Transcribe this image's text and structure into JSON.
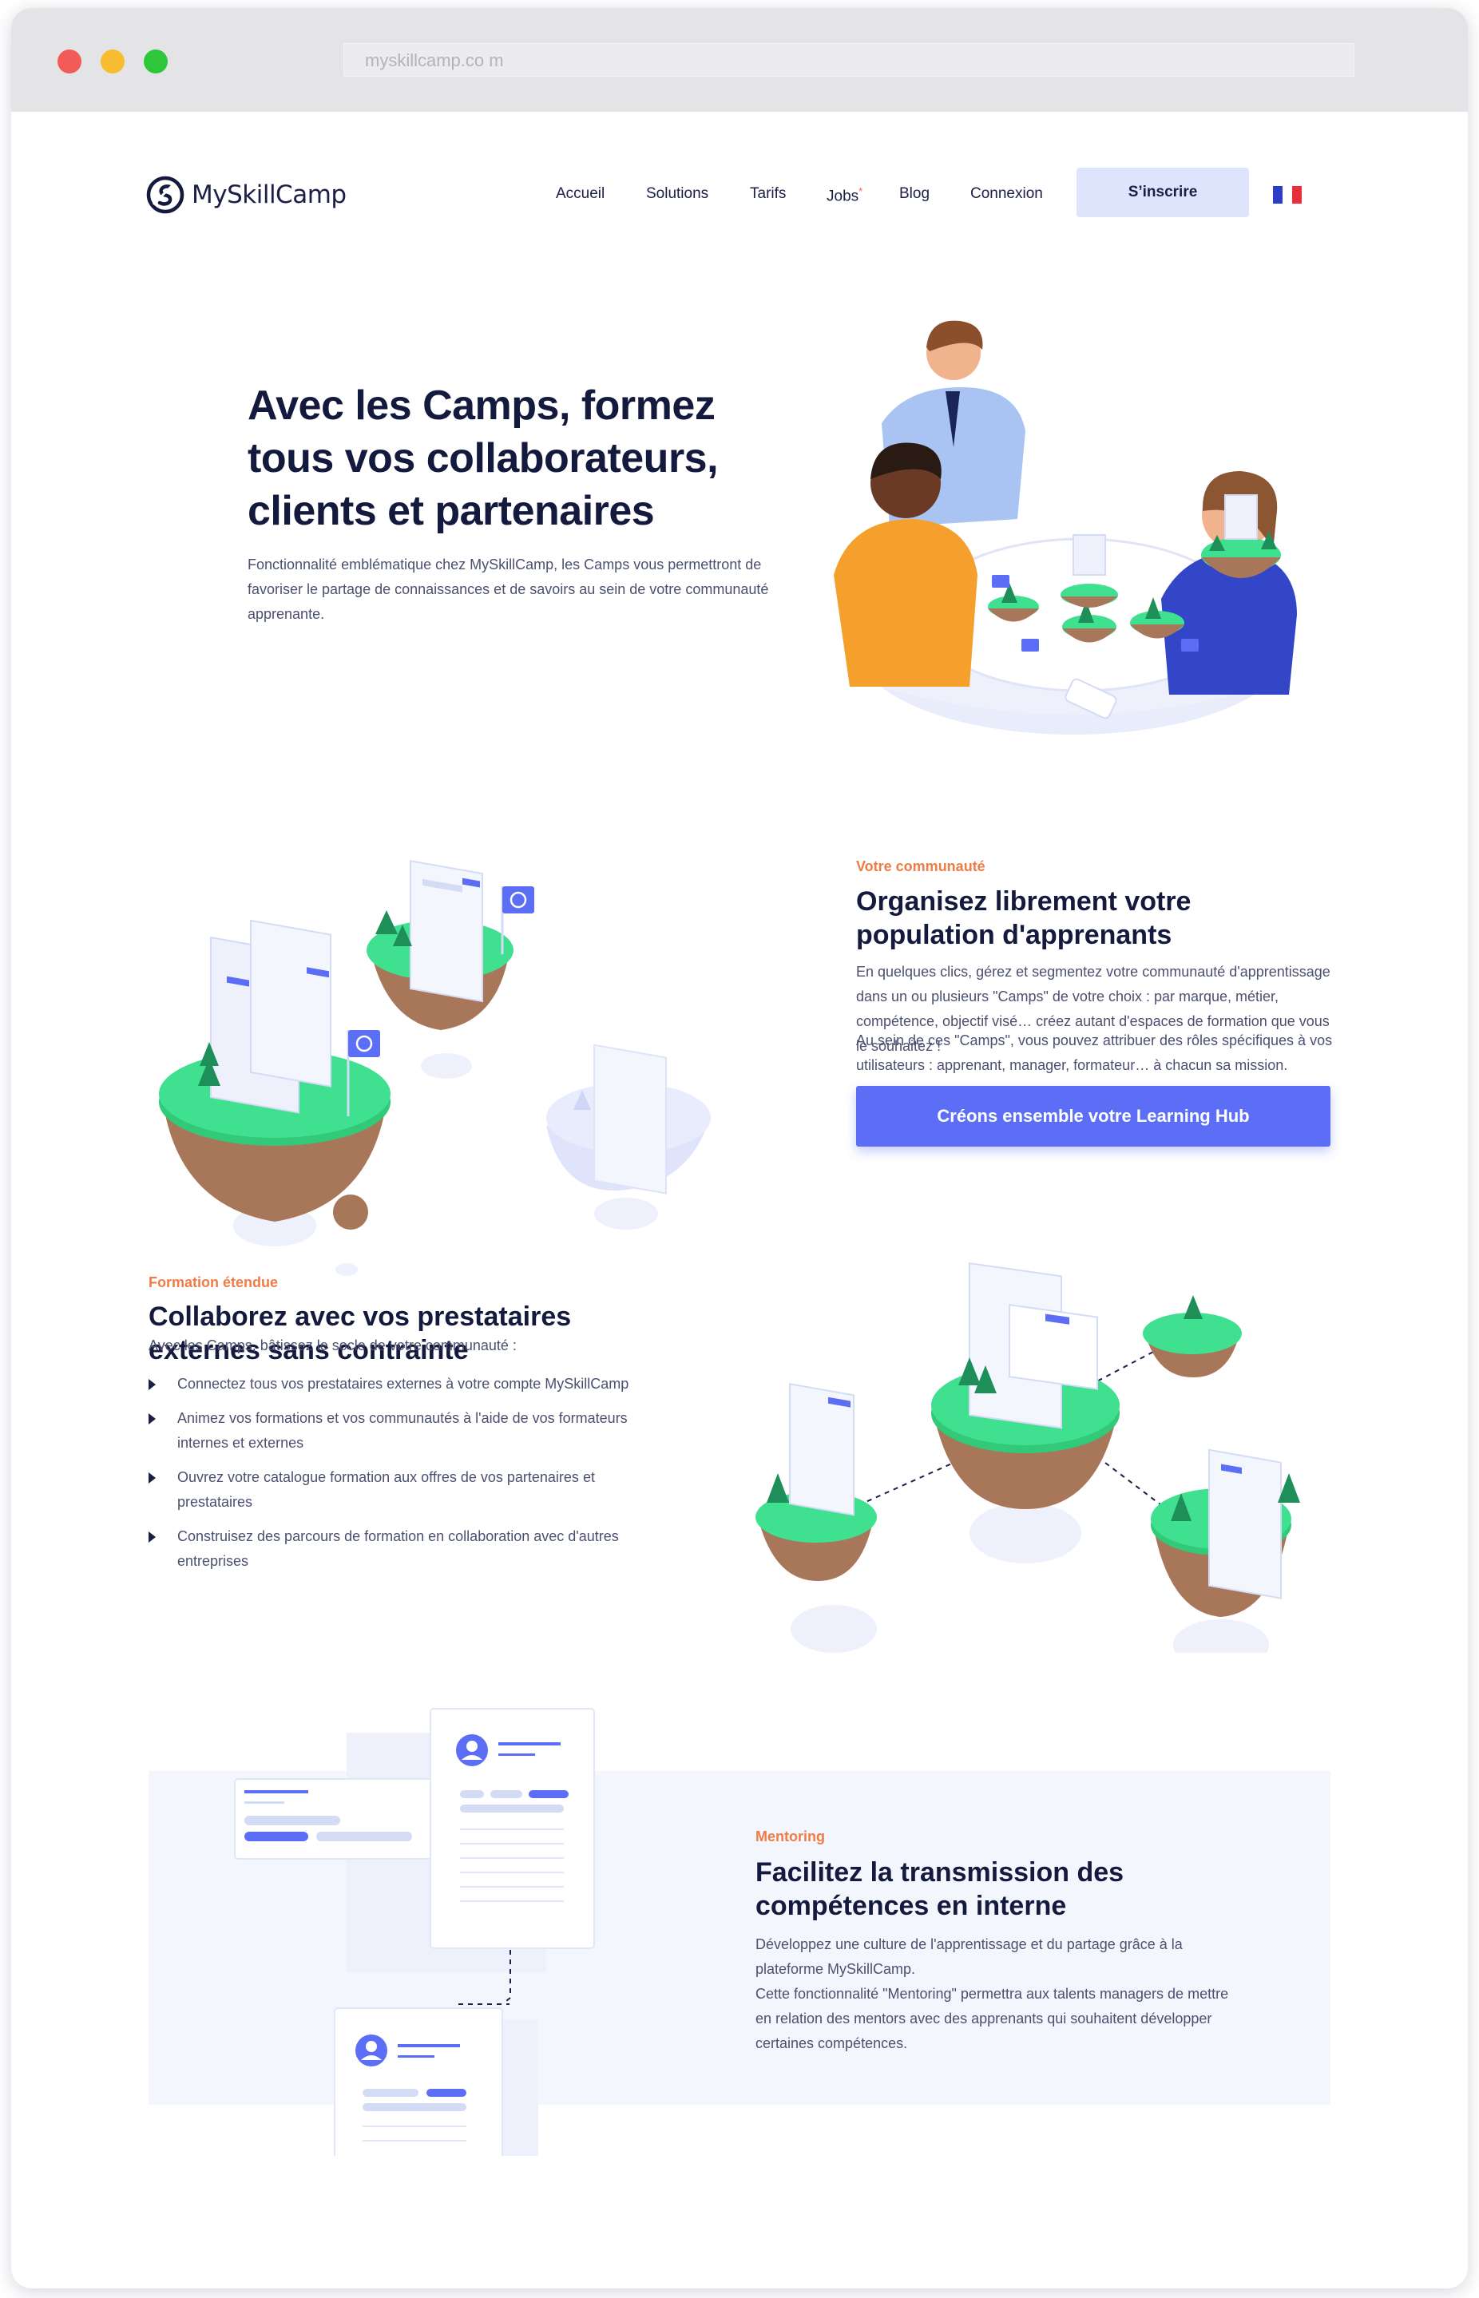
{
  "browser": {
    "url": "myskillcamp.co m"
  },
  "header": {
    "logo_text": "MySkillCamp",
    "nav": [
      {
        "label": "Accueil"
      },
      {
        "label": "Solutions"
      },
      {
        "label": "Tarifs"
      },
      {
        "label": "Jobs",
        "badge": "*"
      },
      {
        "label": "Blog"
      },
      {
        "label": "Connexion"
      }
    ],
    "signup_label": "S’inscrire",
    "language_flag": "fr-flag-icon"
  },
  "hero": {
    "title": "Avec les Camps, formez tous vos collaborateurs, clients et partenaires",
    "description": "Fonctionnalité emblématique chez MySkillCamp, les Camps vous permettront de favoriser le partage de connaissances et de savoirs au sein de votre communauté apprenante."
  },
  "community": {
    "eyebrow": "Votre communauté",
    "title": "Organisez librement votre population d'apprenants",
    "paragraph1": "En quelques clics, gérez et segmentez votre communauté d'apprentissage dans un ou plusieurs \"Camps\" de votre choix : par marque, métier, compétence, objectif visé… créez autant d'espaces de formation que vous le souhaitez !",
    "paragraph2": "Au sein de ces \"Camps\", vous pouvez attribuer des rôles spécifiques à vos utilisateurs : apprenant, manager, formateur… à chacun sa mission.",
    "cta_label": "Créons ensemble votre Learning Hub"
  },
  "external": {
    "eyebrow": "Formation étendue",
    "title": "Collaborez avec vos prestataires externes sans contrainte",
    "intro": "Avec les Camps, bâtissez le socle de votre communauté :",
    "bullets": [
      "Connectez tous vos prestataires externes à votre compte MySkillCamp",
      "Animez vos formations et vos communautés à l'aide de vos formateurs internes et externes",
      "Ouvrez votre catalogue formation aux offres de vos partenaires et prestataires",
      "Construisez des parcours de formation en collaboration avec d'autres entreprises"
    ]
  },
  "mentoring": {
    "eyebrow": "Mentoring",
    "title": "Facilitez la transmission des compétences en interne",
    "paragraph": "Développez une culture de l'apprentissage et du partage grâce à la plateforme MySkillCamp.",
    "paragraph2": "Cette fonctionnalité \"Mentoring\" permettra aux talents managers de mettre en relation des mentors avec des apprenants qui souhaitent développer certaines compétences."
  },
  "colors": {
    "accent": "#5b6ef5",
    "eyebrow": "#ef7c45",
    "heading": "#141a3d",
    "island_green": "#3fe08f",
    "island_soil": "#a8775a",
    "signup_bg": "#dde4fb",
    "mentoring_bg": "#f3f6fd"
  }
}
